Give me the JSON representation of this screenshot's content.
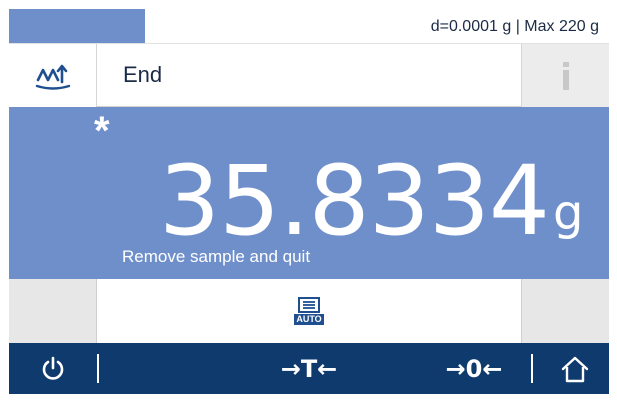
{
  "status": {
    "readability_capacity": "d=0.0001 g | Max 220 g"
  },
  "header": {
    "title": "End",
    "method_icon": "weighing-method-icon",
    "info_icon": "info-icon"
  },
  "weight": {
    "stability_marker": "*",
    "value": "35.8334",
    "unit": "g",
    "message": "Remove sample and quit"
  },
  "softkeys": {
    "center_icon": "auto-print-icon",
    "center_badge": "AUTO"
  },
  "nav": {
    "power_icon": "power-icon",
    "tare_label": "→T←",
    "zero_label": "→0←",
    "home_icon": "home-icon"
  },
  "colors": {
    "accent": "#6f8fcb",
    "navbar": "#0f3a6e",
    "text_dark": "#1b2b46"
  }
}
